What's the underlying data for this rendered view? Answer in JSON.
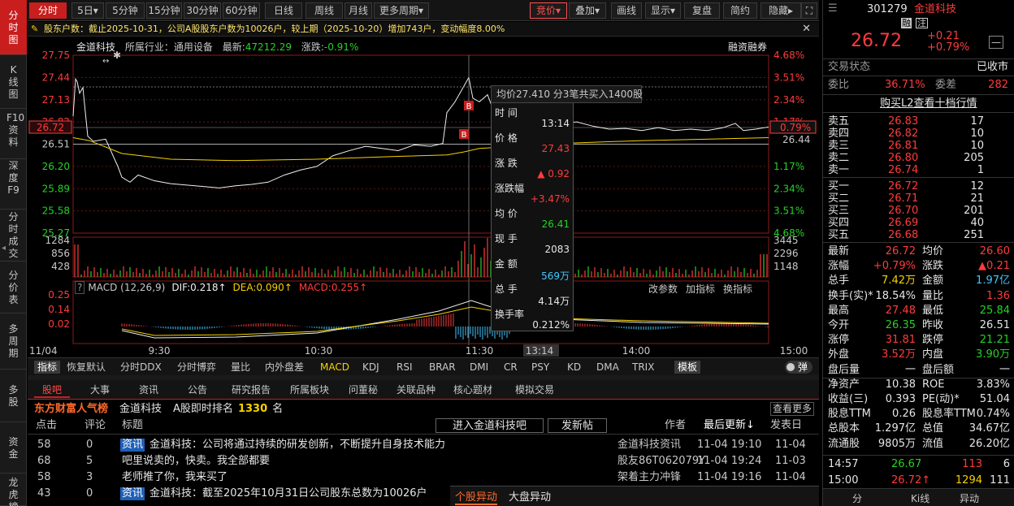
{
  "sidebar": [
    "分时图",
    "K线图",
    "F10资料",
    "深度F9",
    "分时成交",
    "分价表",
    "多周期",
    "多股",
    "资金",
    "龙虎榜"
  ],
  "toolbar": {
    "left": [
      "分时",
      "5日▾",
      "5分钟",
      "15分钟",
      "30分钟",
      "60分钟",
      "日线",
      "周线",
      "月线",
      "更多周期▾"
    ],
    "right": [
      "竞价▾",
      "叠加▾",
      "画线",
      "显示▾",
      "复盘",
      "简约",
      "隐藏▸"
    ]
  },
  "notice": "股东户数：截止2025-10-31，公司A股股东户数为10026户，较上期（2025-10-20）增加743户，变动幅度8.00%",
  "chart_header": {
    "name": "金道科技",
    "industry_label": "所属行业：",
    "industry": "通用设备",
    "latest_label": "最新:",
    "latest": "47212.29",
    "change_label": "涨跌:",
    "change": "-0.91%",
    "margin": "融资融券"
  },
  "chart_data": {
    "type": "line",
    "y_left": [
      "27.75",
      "27.44",
      "27.13",
      "26.82",
      "26.51",
      "26.20",
      "25.89",
      "25.58",
      "25.27"
    ],
    "y_right": [
      "4.68%",
      "3.51%",
      "2.34%",
      "1.17%",
      "",
      "1.17%",
      "2.34%",
      "3.51%",
      "4.68%"
    ],
    "price_tag_left": "26.72",
    "price_tag_right": "0.79%",
    "avg_tag_right": "26.44",
    "prev_close": 26.51,
    "ylim": [
      25.27,
      27.75
    ],
    "x_labels": [
      "11/04",
      "9:30",
      "10:30",
      "11:30",
      "13:14",
      "14:00",
      "15:00"
    ],
    "volume_left": [
      "1284",
      "856",
      "428"
    ],
    "volume_right": [
      "3445",
      "2296",
      "1148"
    ],
    "macd_header": {
      "name": "MACD (12,26,9)",
      "dif": "DIF:0.218↑",
      "dea": "DEA:0.090↑",
      "macd": "MACD:0.255↑"
    },
    "macd_left": [
      "0.25",
      "0.14",
      "0.02"
    ],
    "macd_buttons": [
      "改参数",
      "加指标",
      "换指标"
    ]
  },
  "tooltip": {
    "top": "均价27.410  分3笔共买入1400股",
    "rows": [
      {
        "label": "时 间",
        "value": "13:14"
      },
      {
        "label": "价 格",
        "value": "27.43"
      },
      {
        "label": "涨 跌",
        "value": "▲ 0.92"
      },
      {
        "label": "涨跌幅",
        "value": "+3.47%"
      },
      {
        "label": "均 价",
        "value": "26.41"
      },
      {
        "label": "现 手",
        "value": "2083"
      },
      {
        "label": "金 额",
        "value": "569万"
      },
      {
        "label": "总 手",
        "value": "4.14万"
      },
      {
        "label": "换手率",
        "value": "0.212%"
      }
    ]
  },
  "indicators": [
    "指标",
    "恢复默认",
    "分时DDX",
    "分时博弈",
    "量比",
    "内外盘差",
    "MACD",
    "KDJ",
    "RSI",
    "BRAR",
    "DMI",
    "CR",
    "PSY",
    "KD",
    "DMA",
    "TRIX",
    "模板",
    "弹"
  ],
  "tabs2": [
    "股吧",
    "大事",
    "资讯",
    "公告",
    "研究报告",
    "所属板块",
    "问董秘",
    "关联品种",
    "核心题材",
    "模拟交易"
  ],
  "guba": {
    "title": "东方财富人气榜",
    "stock": "金道科技",
    "rank_label": "A股即时排名",
    "rank": "1330",
    "rank_unit": "名",
    "more": "查看更多",
    "cols": [
      "点击",
      "评论",
      "标题",
      "进入金道科技吧",
      "发新帖",
      "作者",
      "最后更新↓",
      "发表日"
    ],
    "rows": [
      {
        "clicks": "58",
        "comments": "0",
        "tag": "资讯",
        "title": "金道科技：公司将通过持续的研发创新，不断提升自身技术能力",
        "author": "金道科技资讯",
        "updated": "11-04 19:10",
        "date": "11-04"
      },
      {
        "clicks": "68",
        "comments": "5",
        "tag": "",
        "title": "吧里说卖的，快卖。我全部都要",
        "author": "股友86T062079Y",
        "updated": "11-04 19:24",
        "date": "11-03"
      },
      {
        "clicks": "58",
        "comments": "3",
        "tag": "",
        "title": "老师推了你，我来买了",
        "author": "架着主力冲锋",
        "updated": "11-04 19:16",
        "date": "11-04"
      },
      {
        "clicks": "43",
        "comments": "0",
        "tag": "资讯",
        "title": "金道科技：截至2025年10月31日公司股东总数为10026户",
        "author": "",
        "updated": "",
        "date": ""
      }
    ],
    "popup_tabs": [
      "个股异动",
      "大盘异动",
      "[设]"
    ]
  },
  "quote": {
    "code": "301279",
    "name": "金道科技",
    "flags": [
      "融",
      "注"
    ],
    "price": "26.72",
    "chg": "+0.21",
    "pct": "+0.79%",
    "status_label": "交易状态",
    "status": "已收市",
    "wb_label": "委比",
    "wb": "36.71%",
    "wc_label": "委差",
    "wc": "282",
    "l2": "购买L2查看十档行情",
    "sells": [
      [
        "卖五",
        "26.83",
        "17"
      ],
      [
        "卖四",
        "26.82",
        "10"
      ],
      [
        "卖三",
        "26.81",
        "10"
      ],
      [
        "卖二",
        "26.80",
        "205"
      ],
      [
        "卖一",
        "26.74",
        "1"
      ]
    ],
    "buys": [
      [
        "买一",
        "26.72",
        "12"
      ],
      [
        "买二",
        "26.71",
        "21"
      ],
      [
        "买三",
        "26.70",
        "201"
      ],
      [
        "买四",
        "26.69",
        "40"
      ],
      [
        "买五",
        "26.68",
        "251"
      ]
    ],
    "stats": [
      [
        "最新",
        "26.72",
        "red",
        "均价",
        "26.60",
        "red"
      ],
      [
        "涨幅",
        "+0.79%",
        "red",
        "涨跌",
        "▲0.21",
        "red"
      ],
      [
        "总手",
        "7.42万",
        "yel",
        "金额",
        "1.97亿",
        "cyn"
      ],
      [
        "换手(实)*",
        "18.54%",
        "wht",
        "量比",
        "1.36",
        "red"
      ],
      [
        "最高",
        "27.48",
        "red",
        "最低",
        "25.84",
        "grn"
      ],
      [
        "今开",
        "26.35",
        "grn",
        "昨收",
        "26.51",
        "wht"
      ],
      [
        "涨停",
        "31.81",
        "red",
        "跌停",
        "21.21",
        "grn"
      ],
      [
        "外盘",
        "3.52万",
        "red",
        "内盘",
        "3.90万",
        "grn"
      ],
      [
        "盘后量",
        "一",
        "wht",
        "盘后额",
        "一",
        "wht"
      ],
      [
        "净资产",
        "10.38",
        "wht",
        "ROE",
        "3.83%",
        "wht"
      ],
      [
        "收益(三)",
        "0.393",
        "wht",
        "PE(动)*",
        "51.04",
        "wht"
      ],
      [
        "股息TTM",
        "0.26",
        "wht",
        "股息率TTM",
        "0.74%",
        "wht"
      ],
      [
        "总股本",
        "1.297亿",
        "wht",
        "总值",
        "34.67亿",
        "wht"
      ],
      [
        "流通股",
        "9805万",
        "wht",
        "流值",
        "26.20亿",
        "wht"
      ]
    ],
    "ticks": [
      [
        "14:57",
        "26.67",
        "113",
        "6"
      ],
      [
        "15:00",
        "26.72↑",
        "1294",
        "111"
      ]
    ],
    "bottom_tabs": [
      "分",
      "Ki线",
      "异动"
    ]
  }
}
